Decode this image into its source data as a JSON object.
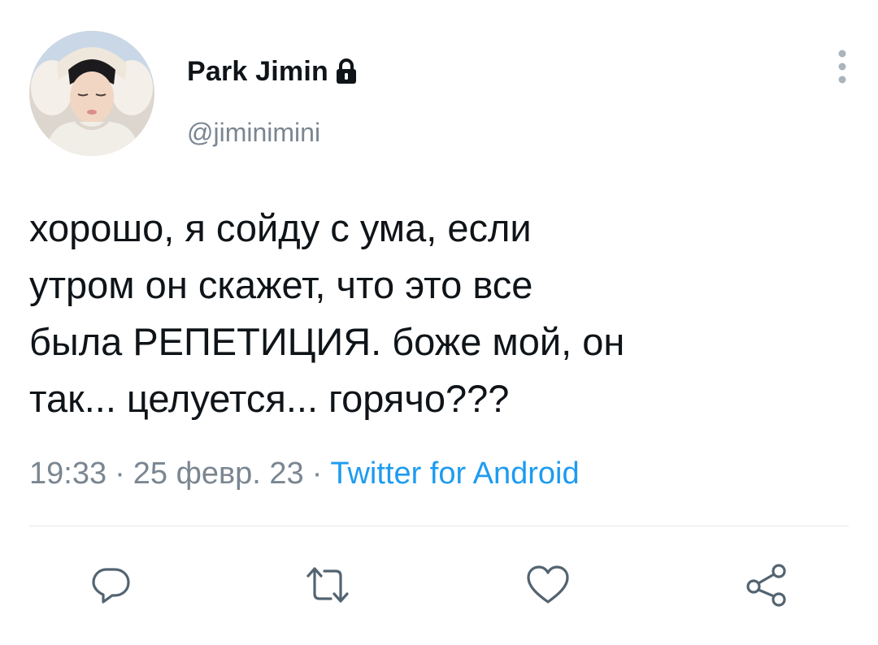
{
  "header": {
    "display_name": "Park Jimin",
    "handle": "@jiminimini",
    "lock_icon": "lock-icon",
    "more_icon": "vertical-dots-icon"
  },
  "tweet": {
    "lines": [
      "хорошо, я сойду с ума, если",
      "утром он скажет, что это все",
      "была РЕПЕТИЦИЯ. боже мой, он",
      "так... целуется... горячо???"
    ]
  },
  "meta": {
    "time": "19:33",
    "separator": "·",
    "date": "25 февр. 23",
    "source": "Twitter for Android"
  },
  "actions": {
    "reply_icon": "reply-icon",
    "retweet_icon": "retweet-icon",
    "like_icon": "heart-icon",
    "share_icon": "share-icon"
  },
  "colors": {
    "text": "#0f1419",
    "secondary": "#7a8691",
    "link": "#1d9bf0",
    "icon": "#536471",
    "divider": "#e1e6ea"
  }
}
